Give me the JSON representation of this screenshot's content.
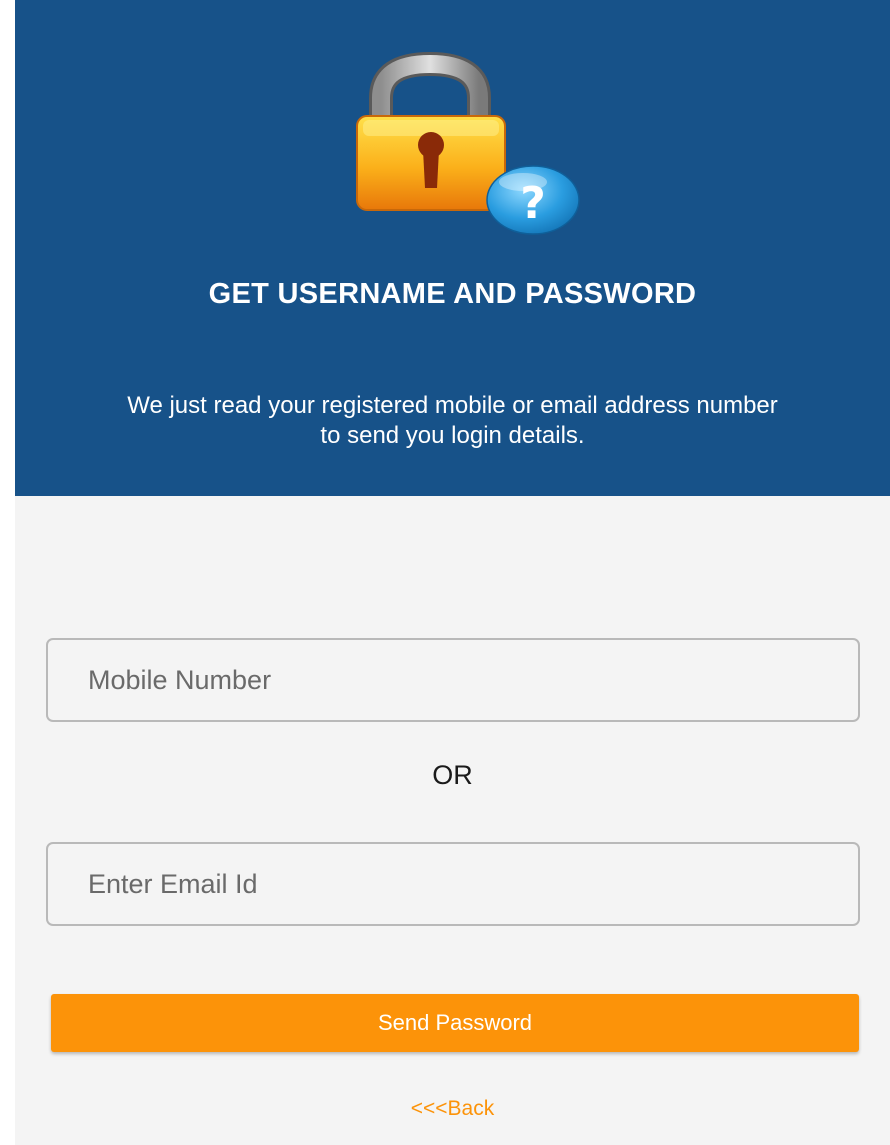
{
  "header": {
    "icon": "lock-question-icon",
    "title": "GET USERNAME AND PASSWORD",
    "subtitle": "We just read your registered mobile or email address number to send you login details.",
    "background_color": "#175289"
  },
  "form": {
    "mobile_placeholder": "Mobile Number",
    "mobile_value": "",
    "or_label": "OR",
    "email_placeholder": "Enter Email Id",
    "email_value": "",
    "send_button_label": "Send Password",
    "back_link_label": "<<<Back"
  },
  "colors": {
    "accent": "#fc9309",
    "page_background": "#f4f4f4"
  }
}
